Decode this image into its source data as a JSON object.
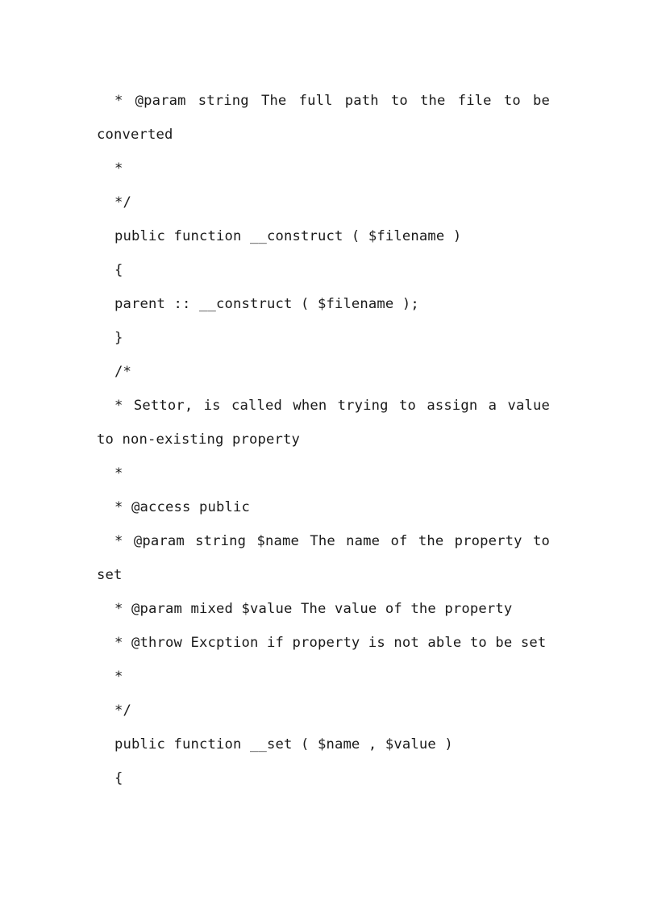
{
  "document": {
    "page_background": "#ffffff",
    "text_color": "#1a1a1a",
    "language": "php",
    "lines": [
      {
        "indent": true,
        "wraps": true,
        "text": "* @param string The full path to the file to be converted"
      },
      {
        "indent": true,
        "wraps": false,
        "text": "*"
      },
      {
        "indent": true,
        "wraps": false,
        "text": "*/"
      },
      {
        "indent": true,
        "wraps": false,
        "text": "public function __construct ( $filename )"
      },
      {
        "indent": true,
        "wraps": false,
        "text": "{"
      },
      {
        "indent": true,
        "wraps": false,
        "text": "parent :: __construct ( $filename );"
      },
      {
        "indent": true,
        "wraps": false,
        "text": "}"
      },
      {
        "indent": true,
        "wraps": false,
        "text": "/*"
      },
      {
        "indent": true,
        "wraps": true,
        "text": "* Settor, is called when trying to assign a value to non-existing property"
      },
      {
        "indent": true,
        "wraps": false,
        "text": "*"
      },
      {
        "indent": true,
        "wraps": false,
        "text": "* @access public"
      },
      {
        "indent": true,
        "wraps": true,
        "text": "* @param string $name The name of the property to set"
      },
      {
        "indent": true,
        "wraps": false,
        "text": "* @param mixed $value The value of the property"
      },
      {
        "indent": true,
        "wraps": true,
        "text": "* @throw Excption if property is not able to be set"
      },
      {
        "indent": true,
        "wraps": false,
        "text": "*"
      },
      {
        "indent": true,
        "wraps": false,
        "text": "*/"
      },
      {
        "indent": true,
        "wraps": false,
        "text": "public function __set ( $name , $value )"
      },
      {
        "indent": true,
        "wraps": false,
        "text": "{"
      }
    ]
  }
}
